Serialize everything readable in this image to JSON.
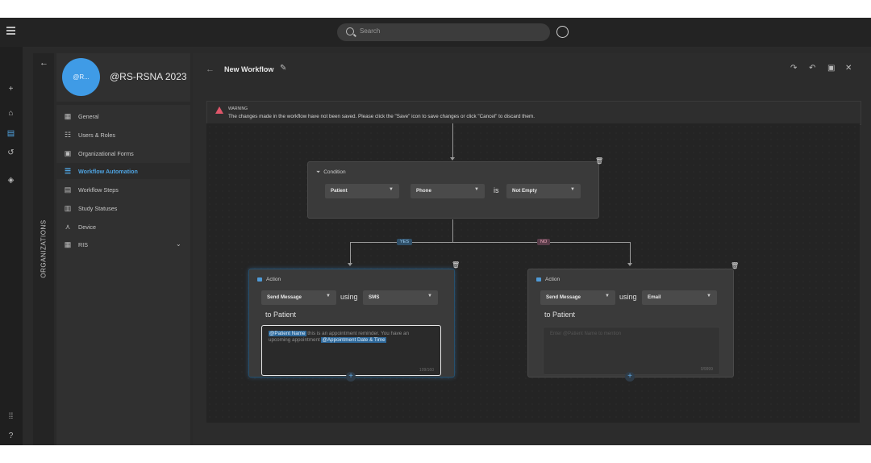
{
  "search": {
    "placeholder": "Search"
  },
  "org": {
    "avatar_text": "@R...",
    "name": "@RS-RSNA 2023",
    "section_label": "ORGANIZATIONS"
  },
  "nav": {
    "items": [
      {
        "label": "General",
        "icon": "building-icon"
      },
      {
        "label": "Users & Roles",
        "icon": "users-icon"
      },
      {
        "label": "Organizational Forms",
        "icon": "form-icon"
      },
      {
        "label": "Workflow Automation",
        "icon": "workflow-icon"
      },
      {
        "label": "Workflow Steps",
        "icon": "steps-icon"
      },
      {
        "label": "Study Statuses",
        "icon": "document-icon"
      },
      {
        "label": "Device",
        "icon": "device-icon"
      },
      {
        "label": "RIS",
        "icon": "calendar-icon"
      }
    ]
  },
  "header": {
    "title": "New Workflow"
  },
  "warning": {
    "title": "WARNING",
    "message": "The changes made in the workflow have not been saved. Please click the \"Save\" icon to save changes or click \"Cancel\" to discard them."
  },
  "condition": {
    "label": "Condition",
    "field1": "Patient",
    "field2": "Phone",
    "operator_word": "is",
    "value": "Not Empty"
  },
  "branches": {
    "yes": "YES",
    "no": "NO"
  },
  "action_left": {
    "label": "Action",
    "action": "Send Message",
    "using_word": "using",
    "channel": "SMS",
    "to_text": "to Patient",
    "tag1": "@Patient Name",
    "text_mid": " this is an appointment reminder. You have an upcoming appointment ",
    "tag2": "@Appointment Date & Time",
    "counter": "109/160"
  },
  "action_right": {
    "label": "Action",
    "action": "Send Message",
    "using_word": "using",
    "channel": "Email",
    "to_text": "to Patient",
    "placeholder": "Enter @Patient Name to mention",
    "counter": "0/9999"
  },
  "colors": {
    "accent": "#4fa3e0",
    "avatar": "#3f9be6",
    "warning": "#e0566a",
    "yes_chip": "#2f4f68",
    "no_chip": "#5a3d4a"
  }
}
